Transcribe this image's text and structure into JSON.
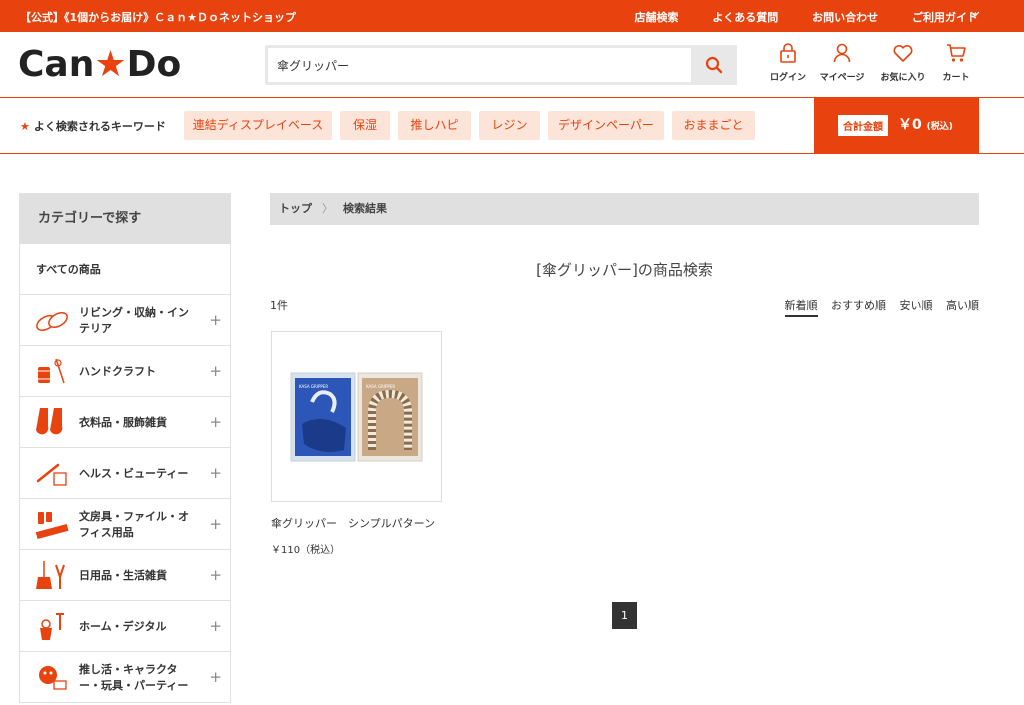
{
  "topbar": {
    "site_text": "【公式】《1個からお届け》Ｃａｎ★Ｄｏネットショップ",
    "links": [
      "店舗検索",
      "よくある質問",
      "お問い合わせ",
      "ご利用ガイド"
    ]
  },
  "header": {
    "logo_text_left": "Can",
    "logo_text_right": "Do",
    "search": {
      "value": "傘グリッパー"
    },
    "icons": [
      {
        "label": "ログイン",
        "icon": "lock-icon"
      },
      {
        "label": "マイページ",
        "icon": "person-icon"
      },
      {
        "label": "お気に入り",
        "icon": "heart-icon"
      },
      {
        "label": "カート",
        "icon": "cart-icon"
      }
    ]
  },
  "keywords": {
    "label": "よく検索されるキーワード",
    "items": [
      "連結ディスプレイベース",
      "保湿",
      "推しハピ",
      "レジン",
      "デザインペーパー",
      "おままごと"
    ]
  },
  "cart_total": {
    "label": "合計金額",
    "amount": "￥0",
    "tax": "(税込)"
  },
  "sidebar": {
    "title": "カテゴリーで探す",
    "all_label": "すべての商品",
    "categories": [
      {
        "label": "リビング・収納・インテリア",
        "icon": "slippers-icon"
      },
      {
        "label": "ハンドクラフト",
        "icon": "thread-icon"
      },
      {
        "label": "衣料品・服飾雑貨",
        "icon": "socks-icon"
      },
      {
        "label": "ヘルス・ビューティー",
        "icon": "brush-icon"
      },
      {
        "label": "文房具・ファイル・オフィス用品",
        "icon": "ruler-icon"
      },
      {
        "label": "日用品・生活雑貨",
        "icon": "broom-icon"
      },
      {
        "label": "ホーム・デジタル",
        "icon": "tools-icon"
      },
      {
        "label": "推し活・キャラクター・玩具・パーティー",
        "icon": "party-icon"
      }
    ]
  },
  "breadcrumb": {
    "home": "トップ",
    "current": "検索結果"
  },
  "results": {
    "title": "[傘グリッパー]の商品検索",
    "count": "1件",
    "sort_options": [
      "新着順",
      "おすすめ順",
      "安い順",
      "高い順"
    ],
    "products": [
      {
        "name": "傘グリッパー　シンプルパターン",
        "price": "￥110（税込）",
        "package_text": "KASA GRIPPER"
      }
    ]
  },
  "pagination": {
    "current": "1"
  },
  "colors": {
    "brand": "#e8430f",
    "keyword_bg": "#fde4d8"
  }
}
